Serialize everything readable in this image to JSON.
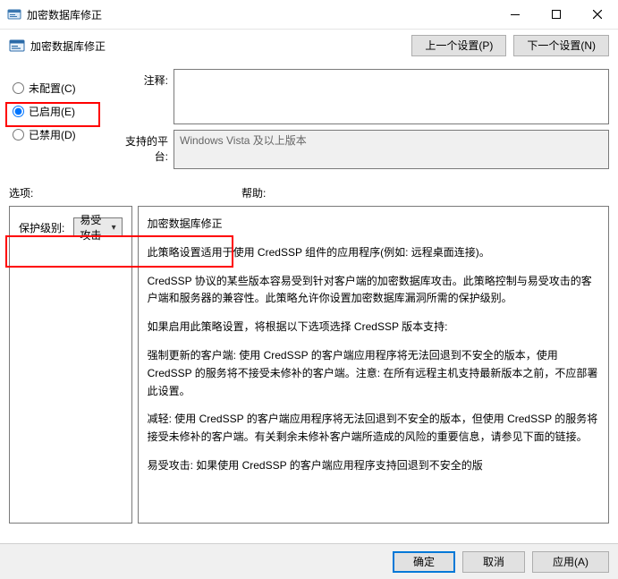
{
  "window": {
    "title": "加密数据库修正"
  },
  "header": {
    "title": "加密数据库修正",
    "prev_btn": "上一个设置(P)",
    "next_btn": "下一个设置(N)"
  },
  "state": {
    "not_configured": "未配置(C)",
    "enabled": "已启用(E)",
    "disabled": "已禁用(D)",
    "selected": "enabled"
  },
  "comment": {
    "label": "注释:",
    "value": ""
  },
  "platform": {
    "label": "支持的平台:",
    "value": "Windows Vista 及以上版本"
  },
  "sections": {
    "options_label": "选项:",
    "help_label": "帮助:"
  },
  "options": {
    "protection_level_label": "保护级别:",
    "protection_level_value": "易受攻击"
  },
  "help": {
    "title": "加密数据库修正",
    "p1": "此策略设置适用于使用 CredSSP 组件的应用程序(例如: 远程桌面连接)。",
    "p2": "CredSSP 协议的某些版本容易受到针对客户端的加密数据库攻击。此策略控制与易受攻击的客户端和服务器的兼容性。此策略允许你设置加密数据库漏洞所需的保护级别。",
    "p3": "如果启用此策略设置，将根据以下选项选择 CredSSP 版本支持:",
    "p4": "强制更新的客户端: 使用 CredSSP 的客户端应用程序将无法回退到不安全的版本，使用 CredSSP 的服务将不接受未修补的客户端。注意: 在所有远程主机支持最新版本之前，不应部署此设置。",
    "p5": "减轻: 使用 CredSSP 的客户端应用程序将无法回退到不安全的版本，但使用 CredSSP 的服务将接受未修补的客户端。有关剩余未修补客户端所造成的风险的重要信息，请参见下面的链接。",
    "p6": "易受攻击: 如果使用 CredSSP 的客户端应用程序支持回退到不安全的版"
  },
  "buttons": {
    "ok": "确定",
    "cancel": "取消",
    "apply": "应用(A)"
  }
}
